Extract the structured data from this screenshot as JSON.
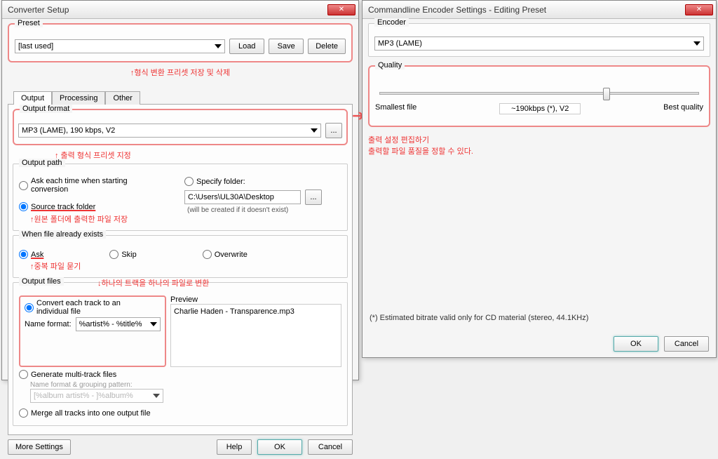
{
  "converter": {
    "title": "Converter Setup",
    "preset": {
      "legend": "Preset",
      "value": "[last used]",
      "load": "Load",
      "save": "Save",
      "delete": "Delete"
    },
    "annotation_preset": "↑형식 변환 프리셋 저장 및 삭제",
    "tabs": {
      "output": "Output",
      "processing": "Processing",
      "other": "Other"
    },
    "output_format": {
      "legend": "Output format",
      "value": "MP3 (LAME), 190 kbps, V2",
      "annotation": "↑ 출력 형식 프리셋 지정"
    },
    "output_path": {
      "legend": "Output path",
      "ask": "Ask each time when starting conversion",
      "specify": "Specify folder:",
      "folder": "C:\\Users\\UL30A\\Desktop",
      "note": "(will be created if it doesn't exist)",
      "source": "Source track folder",
      "annotation": "↑원본 폴더에 출력한 파일 저장"
    },
    "exists": {
      "legend": "When file already exists",
      "ask": "Ask",
      "skip": "Skip",
      "overwrite": "Overwrite",
      "annotation": "↑중복 파일 묻기"
    },
    "output_files": {
      "legend": "Output files",
      "annotation": "↓하나의 트랙을 하나의 파일로 변환",
      "convert_each": "Convert each track to an individual file",
      "name_format_label": "Name format:",
      "name_format_value": "%artist% - %title%",
      "preview_label": "Preview",
      "preview_value": "Charlie Haden - Transparence.mp3",
      "generate_multi": "Generate multi-track files",
      "grouping_label": "Name format & grouping pattern:",
      "grouping_value": "[%album artist% - ]%album%",
      "merge_all": "Merge all tracks into one output file"
    },
    "more_settings": "More Settings",
    "help": "Help",
    "ok": "OK",
    "cancel": "Cancel"
  },
  "encoder": {
    "title": "Commandline Encoder Settings - Editing Preset",
    "encoder_legend": "Encoder",
    "encoder_value": "MP3 (LAME)",
    "quality_legend": "Quality",
    "smallest": "Smallest file",
    "current": "~190kbps (*), V2",
    "best": "Best quality",
    "annotation1": "출력 설정 편집하기",
    "annotation2": "출력할 파일 품질을 정할 수 있다.",
    "footnote": "(*) Estimated bitrate valid only for CD material (stereo, 44.1KHz)",
    "ok": "OK",
    "cancel": "Cancel"
  }
}
